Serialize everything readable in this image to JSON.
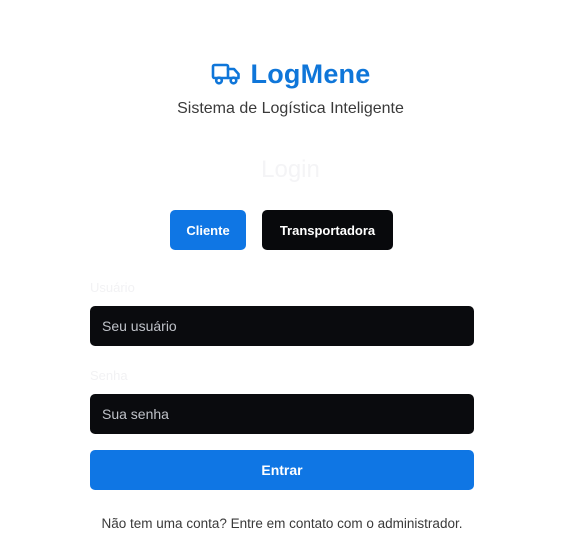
{
  "brand": {
    "icon": "truck-icon",
    "title": "LogMene",
    "subtitle": "Sistema de Logística Inteligente"
  },
  "login": {
    "heading": "Login",
    "user_types": [
      {
        "label": "Cliente",
        "selected": true
      },
      {
        "label": "Transportadora",
        "selected": false
      }
    ],
    "fields": {
      "username_label": "Usuário",
      "username_placeholder": "Seu usuário",
      "password_label": "Senha",
      "password_placeholder": "Sua senha"
    },
    "submit_label": "Entrar",
    "footer_note": "Não tem uma conta? Entre em contato com o administrador."
  },
  "colors": {
    "brand": "#0f76d9",
    "primary_button": "#0f76e4",
    "dark_surface": "#0a0b0e"
  }
}
